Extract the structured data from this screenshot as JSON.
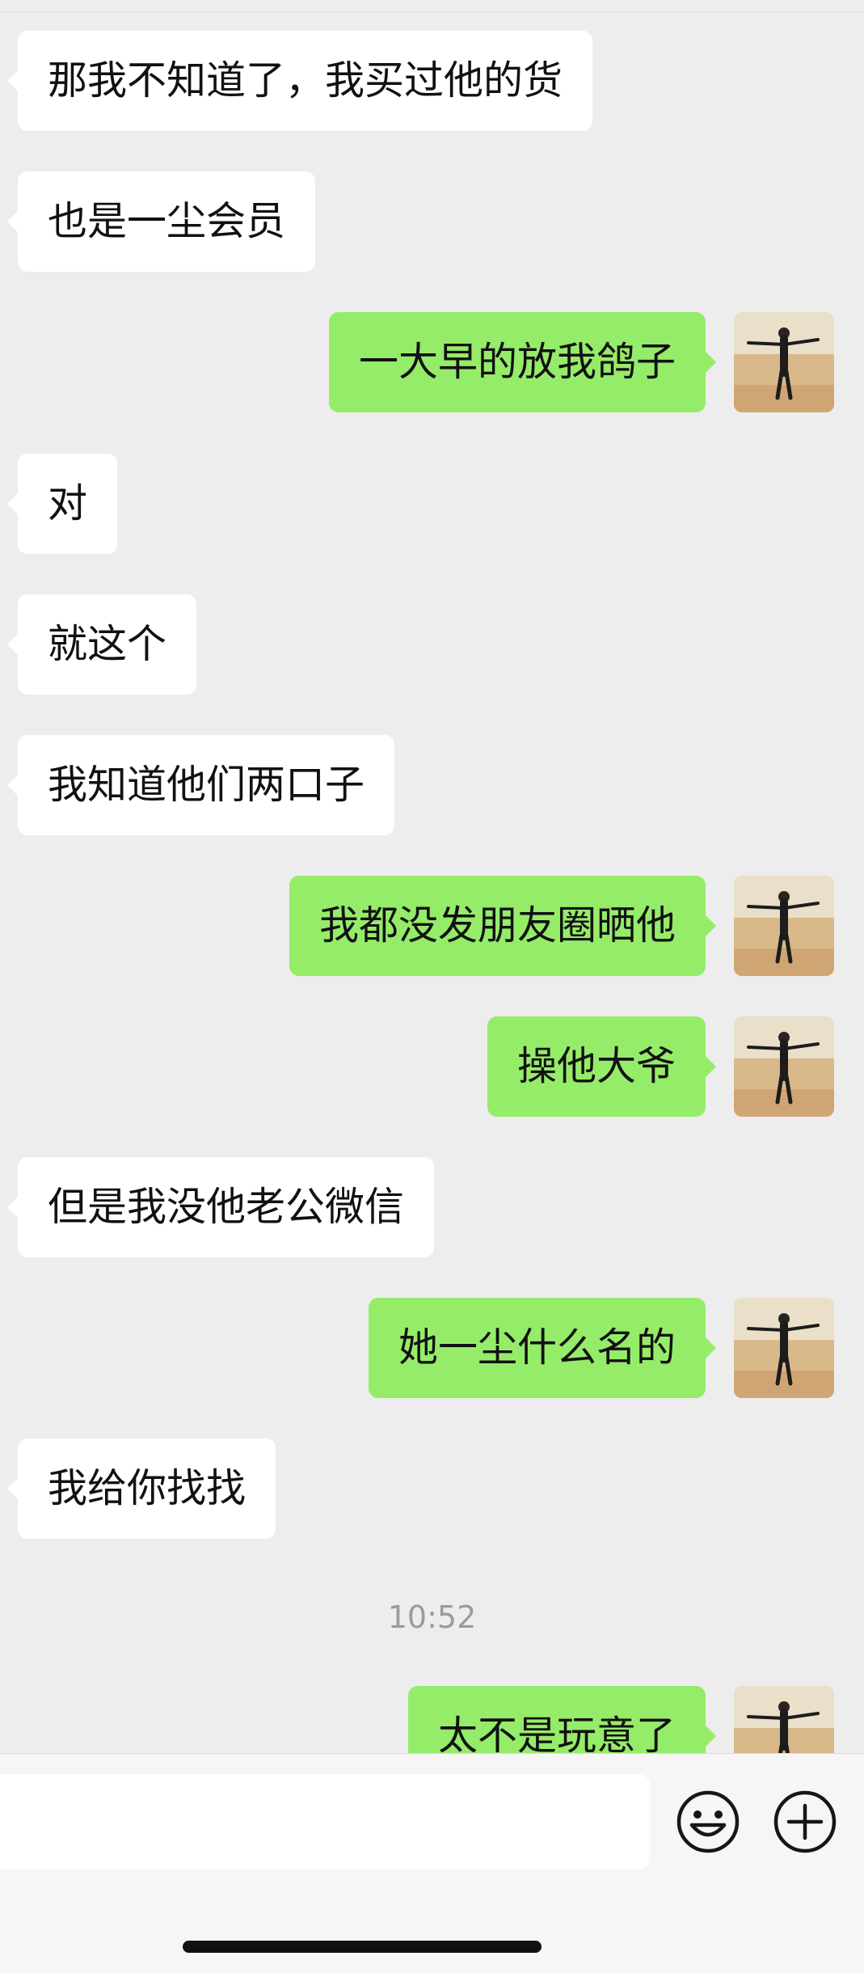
{
  "messages": [
    {
      "side": "in",
      "text": "那我不知道了，我买过他的货"
    },
    {
      "side": "in",
      "text": "也是一尘会员"
    },
    {
      "side": "out",
      "text": "一大早的放我鸽子"
    },
    {
      "side": "in",
      "text": "对"
    },
    {
      "side": "in",
      "text": "就这个"
    },
    {
      "side": "in",
      "text": "我知道他们两口子"
    },
    {
      "side": "out",
      "text": "我都没发朋友圈晒他"
    },
    {
      "side": "out",
      "text": "操他大爷"
    },
    {
      "side": "in",
      "text": "但是我没他老公微信"
    },
    {
      "side": "out",
      "text": "她一尘什么名的"
    },
    {
      "side": "in",
      "text": "我给你找找"
    },
    {
      "side": "out",
      "text": "太不是玩意了"
    }
  ],
  "timestamp": "10:52",
  "input": {
    "value": "",
    "placeholder": ""
  },
  "icons": {
    "emoji": "emoji-icon",
    "more": "plus-icon"
  },
  "colors": {
    "background": "#ededed",
    "incoming_bubble": "#ffffff",
    "outgoing_bubble": "#95ec69"
  }
}
